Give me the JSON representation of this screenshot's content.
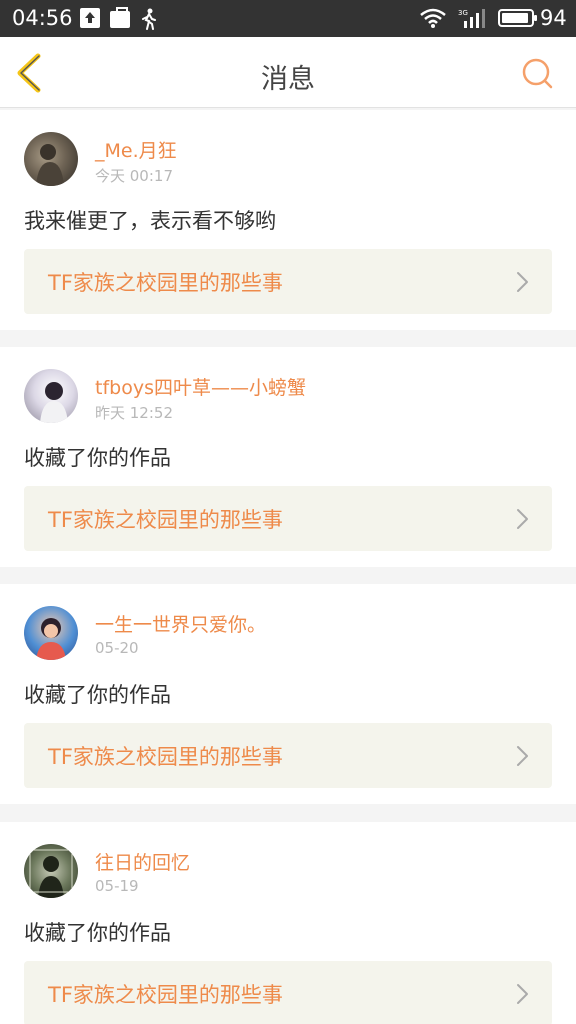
{
  "status_bar": {
    "time": "04:56",
    "battery_level": "94",
    "icons": [
      "upload-icon",
      "bag-icon",
      "walking-icon",
      "wifi-icon",
      "signal-3g-icon",
      "battery-icon"
    ]
  },
  "nav": {
    "title": "消息",
    "back_icon": "back-chevron-icon",
    "search_icon": "search-icon",
    "accent_color": "#f5a623"
  },
  "messages": [
    {
      "username": "_Me.月狂",
      "time": "今天 00:17",
      "text": "我来催更了，表示看不够哟",
      "work_title": "TF家族之校园里的那些事"
    },
    {
      "username": "tfboys四叶草——小螃蟹",
      "time": "昨天 12:52",
      "text": "收藏了你的作品",
      "work_title": "TF家族之校园里的那些事"
    },
    {
      "username": "一生一世界只爱你。",
      "time": "05-20",
      "text": "收藏了你的作品",
      "work_title": "TF家族之校园里的那些事"
    },
    {
      "username": "往日的回忆",
      "time": "05-19",
      "text": "收藏了你的作品",
      "work_title": "TF家族之校园里的那些事"
    }
  ],
  "colors": {
    "username": "#ee8a4a",
    "work_link_bg": "#f4f4ec",
    "status_bar_bg": "#333333"
  }
}
